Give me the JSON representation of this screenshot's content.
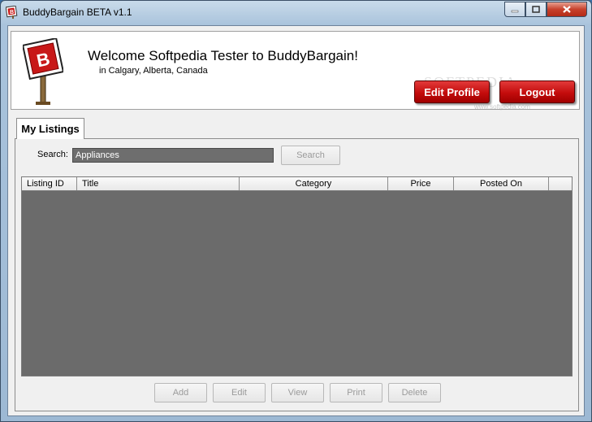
{
  "window": {
    "title": "BuddyBargain BETA v1.1",
    "icons": {
      "app": "buddybargain-b-icon",
      "minimize": "minimize-icon",
      "maximize": "maximize-icon",
      "close": "close-icon"
    }
  },
  "header": {
    "welcome": "Welcome Softpedia Tester to BuddyBargain!",
    "location": "in Calgary, Alberta, Canada",
    "logo_letter": "B",
    "edit_profile_label": "Edit Profile",
    "logout_label": "Logout",
    "watermark": "SOFTPEDIA",
    "watermark_url": "www.softpedia.com"
  },
  "tabs": [
    {
      "label": "My Listings",
      "active": true
    }
  ],
  "search": {
    "label": "Search:",
    "value": "Appliances",
    "button_label": "Search"
  },
  "listings_table": {
    "columns": [
      "Listing ID",
      "Title",
      "Category",
      "Price",
      "Posted On"
    ],
    "rows": []
  },
  "actions": {
    "add_label": "Add",
    "edit_label": "Edit",
    "view_label": "View",
    "print_label": "Print",
    "delete_label": "Delete"
  },
  "colors": {
    "accent_red": "#c40c0c",
    "grid_bg": "#6b6b6b"
  }
}
